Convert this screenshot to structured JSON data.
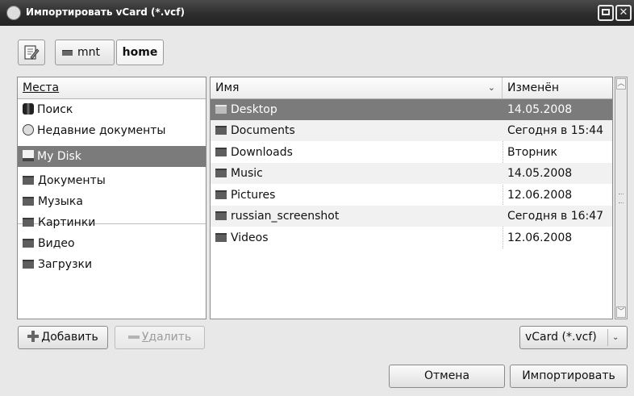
{
  "window": {
    "title": "Импортировать vCard (*.vcf)",
    "icon": "app-icon",
    "close_glyph": "✕"
  },
  "toolbar": {
    "edit_icon": "pencil-icon",
    "crumbs": [
      "mnt",
      "home"
    ]
  },
  "places": {
    "header": "Места",
    "items": [
      {
        "label": "Поиск",
        "icon": "binoculars-icon"
      },
      {
        "label": "Недавние документы",
        "icon": "clock-icon"
      },
      {
        "label": "My Disk",
        "icon": "disk-icon"
      },
      {
        "label": "Документы",
        "icon": "folder-icon"
      },
      {
        "label": "Музыка",
        "icon": "folder-icon"
      },
      {
        "label": "Картинки",
        "icon": "folder-icon"
      },
      {
        "label": "Видео",
        "icon": "folder-icon"
      },
      {
        "label": "Загрузки",
        "icon": "folder-icon"
      }
    ]
  },
  "files": {
    "col_name": "Имя",
    "col_modified": "Изменён",
    "sort_glyph": "⌄",
    "rows": [
      {
        "name": "Desktop",
        "modified": "14.05.2008"
      },
      {
        "name": "Documents",
        "modified": "Сегодня в 15:44"
      },
      {
        "name": "Downloads",
        "modified": "Вторник"
      },
      {
        "name": "Music",
        "modified": "14.05.2008"
      },
      {
        "name": "Pictures",
        "modified": "12.06.2008"
      },
      {
        "name": "russian_screenshot",
        "modified": "Сегодня в 16:47"
      },
      {
        "name": "Videos",
        "modified": "12.06.2008"
      }
    ]
  },
  "buttons": {
    "add_first": "Д",
    "add_rest": "обавить",
    "remove_first": "У",
    "remove_rest": "далить",
    "filter": "vCard (*.vcf)",
    "filter_glyph": "⌄",
    "cancel": "Отмена",
    "import": "Импортировать"
  },
  "colors": {
    "titlebar": "#2d2d2d",
    "selection": "#7b7b7b",
    "background": "#e8e8e8"
  }
}
